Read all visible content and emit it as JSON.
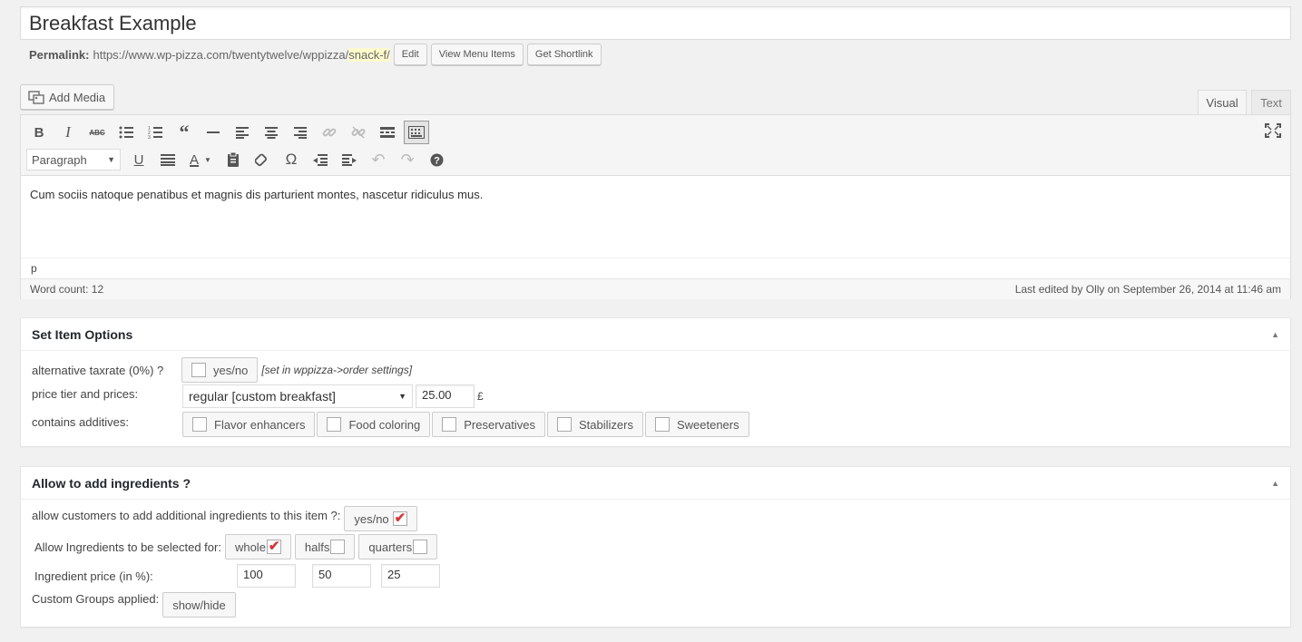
{
  "post": {
    "title": "Breakfast Example",
    "permalink_label": "Permalink:",
    "permalink_base": "https://www.wp-pizza.com/twentytwelve/wppizza/",
    "permalink_slug": "snack-f/",
    "edit_label": "Edit",
    "view_items_label": "View Menu Items",
    "shortlink_label": "Get Shortlink"
  },
  "editor": {
    "add_media_label": "Add Media",
    "tab_visual": "Visual",
    "tab_text": "Text",
    "format_select": "Paragraph",
    "content": "Cum sociis natoque penatibus et magnis dis parturient montes, nascetur ridiculus mus.",
    "path": "p",
    "word_count": "Word count: 12",
    "last_edited": "Last edited by Olly on September 26, 2014 at 11:46 am",
    "toolbar_row1": [
      "bold-icon",
      "italic-icon",
      "strikethrough-icon",
      "bullet-list-icon",
      "numbered-list-icon",
      "blockquote-icon",
      "horizontal-rule-icon",
      "align-left-icon",
      "align-center-icon",
      "align-right-icon",
      "link-icon",
      "unlink-icon",
      "read-more-icon",
      "toolbar-toggle-icon"
    ],
    "toolbar_row2": [
      "underline-icon",
      "justify-icon",
      "text-color-icon",
      "paste-text-icon",
      "clear-formatting-icon",
      "special-character-icon",
      "outdent-icon",
      "indent-icon",
      "undo-icon",
      "redo-icon",
      "help-icon"
    ]
  },
  "item_options": {
    "title": "Set Item Options",
    "taxrate_label": "alternative taxrate (0%) ?",
    "taxrate_chip": "yes/no",
    "taxrate_note": "[set in wppizza->order settings]",
    "price_label": "price tier and prices:",
    "price_tier": "regular [custom breakfast]",
    "price_value": "25.00",
    "currency": "£",
    "additives_label": "contains additives:",
    "additives": [
      "Flavor enhancers",
      "Food coloring",
      "Preservatives",
      "Stabilizers",
      "Sweeteners"
    ]
  },
  "ingredients": {
    "title": "Allow to add ingredients ?",
    "allow_label": "allow customers to add additional ingredients to this item ?:",
    "allow_chip": "yes/no",
    "select_for_label": "Allow Ingredients to be selected for:",
    "sizes": [
      {
        "label": "whole",
        "checked": true
      },
      {
        "label": "halfs",
        "checked": false
      },
      {
        "label": "quarters",
        "checked": false
      }
    ],
    "price_label": "Ingredient price (in %):",
    "prices": [
      "100",
      "50",
      "25"
    ],
    "custom_groups_label": "Custom Groups applied:",
    "show_hide_label": "show/hide"
  },
  "colors": {
    "accent": "#d63638",
    "highlight": "#fffbcc"
  }
}
